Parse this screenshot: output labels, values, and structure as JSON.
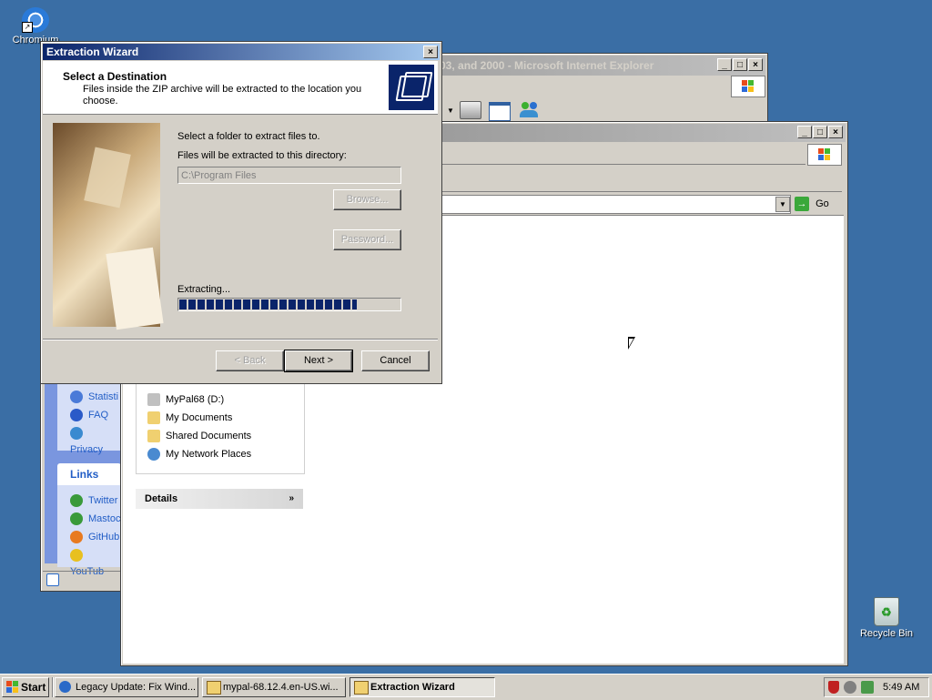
{
  "desktop": {
    "icons": [
      {
        "label": "Chromium"
      },
      {
        "label": "Recycle Bin"
      }
    ]
  },
  "ie_window": {
    "title": "03, and 2000 - Microsoft Internet Explorer"
  },
  "explorer_window": {
    "go_label": "Go",
    "left_links": [
      "Statisti",
      "FAQ",
      "Privacy"
    ],
    "links_header": "Links",
    "links": [
      "Twitter",
      "Mastoc",
      "GitHub",
      "YouTub"
    ],
    "other_places": [
      "MyPal68 (D:)",
      "My Documents",
      "Shared Documents",
      "My Network Places"
    ],
    "details_label": "Details"
  },
  "wizard": {
    "title": "Extraction Wizard",
    "heading": "Select a Destination",
    "subheading": "Files inside the ZIP archive will be extracted to the location you choose.",
    "select_label": "Select a folder to extract files to.",
    "dir_label": "Files will be extracted to this directory:",
    "path_value": "C:\\Program Files",
    "browse_label": "Browse...",
    "password_label": "Password...",
    "extracting_label": "Extracting...",
    "progress": 0.8,
    "back_label": "< Back",
    "next_label": "Next >",
    "cancel_label": "Cancel"
  },
  "taskbar": {
    "start_label": "Start",
    "items": [
      {
        "label": "Legacy Update: Fix Wind..."
      },
      {
        "label": "mypal-68.12.4.en-US.wi..."
      },
      {
        "label": "Extraction Wizard"
      }
    ],
    "clock": "5:49 AM"
  },
  "colors": {
    "desktop": "#3a6ea5",
    "title_active": "#0a246a",
    "progress": "#0a246a"
  }
}
